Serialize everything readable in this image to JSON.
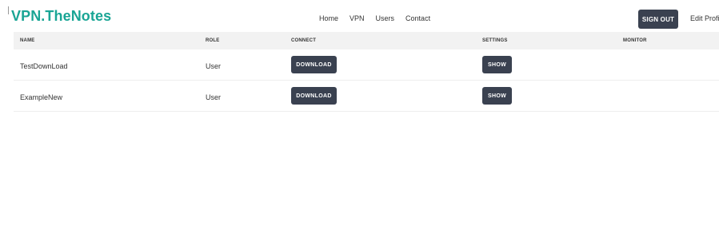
{
  "brand": "VPN.TheNotes",
  "nav": [
    "Home",
    "VPN",
    "Users",
    "Contact"
  ],
  "header_actions": {
    "sign_out": "SIGN OUT",
    "edit_profile": "Edit Profile"
  },
  "table": {
    "columns": [
      "NAME",
      "ROLE",
      "CONNECT",
      "SETTINGS",
      "MONITOR"
    ],
    "rows": [
      {
        "name": "TestDownLoad",
        "role": "User",
        "connect": "DOWNLOAD",
        "settings": "SHOW"
      },
      {
        "name": "ExampleNew",
        "role": "User",
        "connect": "DOWNLOAD",
        "settings": "SHOW"
      }
    ]
  },
  "colors": {
    "brand": "#1aa595",
    "button": "#3a4150",
    "header_bg": "#f2f2f2"
  }
}
